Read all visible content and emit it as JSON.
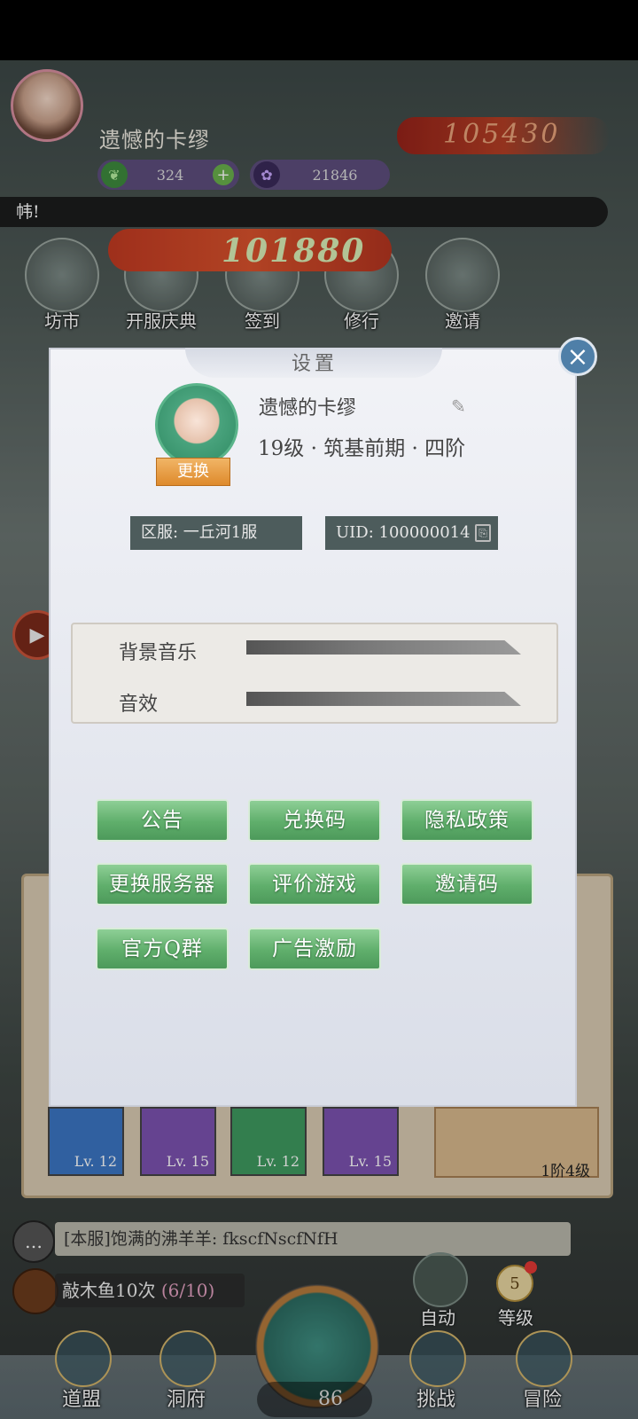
{
  "hud": {
    "player_name": "遗憾的卡缪",
    "jade_count": "324",
    "spirit_count": "21846",
    "combat_power": "105430",
    "ticker_text": "帏!",
    "boost_value": "101880",
    "plus_label": "+"
  },
  "top_menu": [
    {
      "label": "坊市"
    },
    {
      "label": "开服庆典"
    },
    {
      "label": "签到"
    },
    {
      "label": "修行"
    },
    {
      "label": "邀请"
    }
  ],
  "settings": {
    "title": "设置",
    "close_label": "×",
    "profile": {
      "name": "遗憾的卡缪",
      "level_text": "19级 · 筑基前期 · 四阶",
      "change_label": "更换",
      "edit_icon": "✎"
    },
    "server_text": "区服: 一丘河1服",
    "uid_text": "UID: 100000014",
    "audio": {
      "bgm_label": "背景音乐",
      "bgm_level": 0.95,
      "sfx_label": "音效",
      "sfx_level": 0.95
    },
    "buttons": {
      "announcement": "公告",
      "redeem_code": "兑换码",
      "privacy_policy": "隐私政策",
      "change_server": "更换服务器",
      "rate_game": "评价游戏",
      "invite_code": "邀请码",
      "qq_group": "官方Q群",
      "ad_reward": "广告激励"
    }
  },
  "lower": {
    "cards": [
      {
        "level": "Lv. 12",
        "color": "#3b76c4"
      },
      {
        "level": "Lv. 15",
        "color": "#7c52b0"
      },
      {
        "level": "Lv. 12",
        "color": "#3f9a60"
      },
      {
        "level": "Lv. 15",
        "color": "#7c52b0"
      }
    ],
    "right_panel_text": "1阶4级",
    "chat_text": "[本服]饱满的沸羊羊: fkscfNscfNfH",
    "quest_text": "敲木鱼10次",
    "quest_progress": "(6/10)",
    "auto_label": "自动",
    "level_badge": "5",
    "level_label": "等级",
    "fish_count": "86"
  },
  "bottom_nav": [
    {
      "label": "道盟"
    },
    {
      "label": "洞府"
    },
    {
      "label": "挑战"
    },
    {
      "label": "冒险"
    }
  ]
}
